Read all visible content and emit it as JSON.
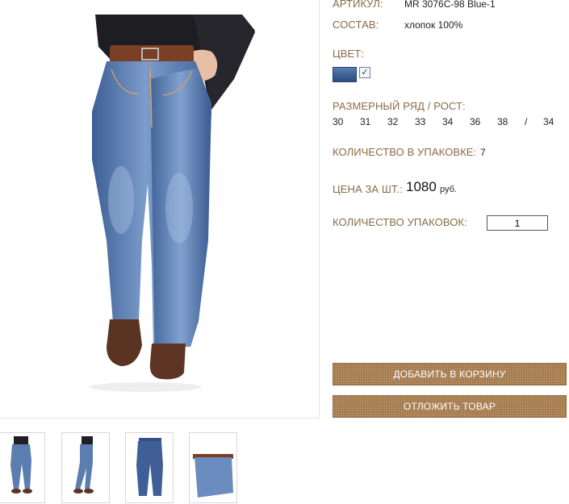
{
  "product": {
    "article_label": "АРТИКУЛ:",
    "article_value": "MR 3076C-98 Blue-1",
    "composition_label": "СОСТАВ:",
    "composition_value": "хлопок 100%",
    "color_label": "ЦВЕТ:",
    "color_swatch": "#3f5f94",
    "color_checked": "✓",
    "sizes_label": "РАЗМЕРНЫЙ РЯД / РОСТ:",
    "sizes": [
      "30",
      "31",
      "32",
      "33",
      "34",
      "36",
      "38",
      "/",
      "34"
    ],
    "pack_qty_label": "КОЛИЧЕСТВО В УПАКОВКЕ:",
    "pack_qty_value": "7",
    "price_label": "ЦЕНА ЗА ШТ.:",
    "price_value": "1080",
    "price_currency": "руб.",
    "packs_label": "КОЛИЧЕСТВО УПАКОВОК:",
    "packs_value": "1"
  },
  "buttons": {
    "add_to_cart": "ДОБАВИТЬ В КОРЗИНУ",
    "defer": "ОТЛОЖИТЬ ТОВАР"
  },
  "colors": {
    "label": "#8a6a44",
    "button": "#a3784a",
    "denim": "#4a6fa5"
  },
  "images": {
    "main": "jeans-front-model",
    "thumbnails": [
      "jeans-front-model",
      "jeans-side-model",
      "jeans-flat-front",
      "jeans-waist-closeup"
    ]
  }
}
